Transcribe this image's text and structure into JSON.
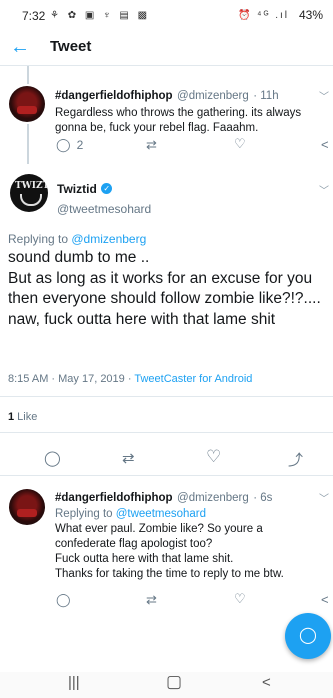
{
  "status": {
    "time": "7:32",
    "left_icons": "⚘ ✿ ▣ ♆ ▤ ▩",
    "right_icons": "⏰ ⁴ᴳ .ıl",
    "battery": "43%"
  },
  "header": {
    "title": "Tweet"
  },
  "tweet1": {
    "name": "#dangerfieldofhiphop",
    "handle": "@dmizenberg",
    "time": "· 11h",
    "text": "Regardless who throws the gathering. its always gonna be, fuck your rebel flag. Faaahm.",
    "reply_count": "2"
  },
  "main": {
    "name": "Twiztid",
    "avatar_text": "TWIZTID",
    "handle": "@tweetmesohard",
    "replying_prefix": "Replying to ",
    "replying_to": "@dmizenberg",
    "text": "sound dumb to me ..\n But as long as it works for an excuse for you then everyone should follow zombie like?!?.... naw, fuck outta here with that lame shit",
    "timestamp": "8:15 AM · May 17, 2019 · ",
    "client": "TweetCaster for Android",
    "likes_count": "1",
    "likes_label": " Like"
  },
  "tweet3": {
    "name": "#dangerfieldofhiphop",
    "handle": "@dmizenberg",
    "time": "· 6s",
    "replying_prefix": "Replying to ",
    "replying_to": "@tweetmesohard",
    "text": "What ever paul. Zombie like? So youre a confederate flag apologist too?\nFuck outta here with that lame shit.\nThanks for taking the time to reply to me btw."
  },
  "colors": {
    "accent": "#1da1f2",
    "muted": "#657786"
  }
}
